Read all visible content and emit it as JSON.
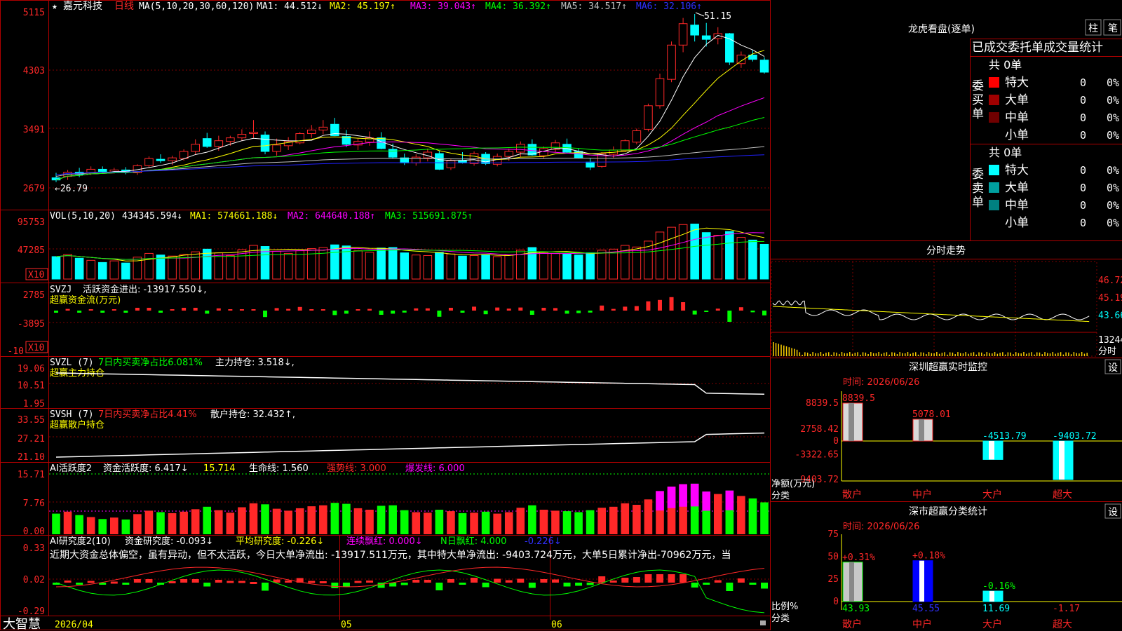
{
  "app": {
    "brand": "大智慧",
    "stock_name": "嘉元科技",
    "period": "日线",
    "marker": "★"
  },
  "colors": {
    "up": "#ff2828",
    "down": "#00ffff",
    "ma1": "#ffffff",
    "ma2": "#ffff00",
    "ma3": "#ff00ff",
    "ma4": "#00ff00",
    "ma5": "#c0c0c0",
    "ma6": "#2020ff",
    "grid": "#b00000"
  },
  "main": {
    "legend": {
      "ma_label": "MA(5,10,20,30,60,120)",
      "ma1": "MA1: 44.512↓",
      "ma2": "MA2: 45.197↑",
      "ma3": "MA3: 39.043↑",
      "ma4": "MA4: 36.392↑",
      "ma5": "MA5: 34.517↑",
      "ma6": "MA6: 32.106↑"
    },
    "yticks": [
      "5115",
      "4303",
      "3491",
      "2679"
    ],
    "high_label": "51.15",
    "low_label": "←26.79"
  },
  "vol": {
    "label": "VOL(5,10,20)",
    "value": "434345.594↓",
    "ma1": "MA1: 574661.188↓",
    "ma2": "MA2: 644640.188↑",
    "ma3": "MA3: 515691.875↑",
    "yticks": [
      "95753",
      "47285"
    ],
    "unit": "X10"
  },
  "svzj": {
    "label": "SVZJ",
    "text": "活跃资金进出: -13917.550↓,",
    "title": "超赢资金流(万元)",
    "yticks": [
      "2785",
      "-3895",
      "-10"
    ],
    "unit": "X10"
  },
  "svzl": {
    "label": "SVZL (7)",
    "text1": "7日内买卖净占比6.081%",
    "text2": "主力持仓: 3.518↓,",
    "title": "超赢主力持仓",
    "yticks": [
      "19.06",
      "10.51",
      "1.95"
    ]
  },
  "svsh": {
    "label": "SVSH (7)",
    "text1": "7日内买卖净占比4.41%",
    "text2": "散户持仓: 32.432↑,",
    "title": "超赢散户持仓",
    "yticks": [
      "33.55",
      "27.21",
      "21.10"
    ]
  },
  "ai1": {
    "label": "AI活跃度2",
    "t1": "资金活跃度: 6.417↓",
    "t2": "15.714",
    "t3": "生命线: 1.560",
    "t4": "强势线: 3.000",
    "t5": "爆发线: 6.000",
    "yticks": [
      "15.71",
      "7.76",
      "0.00"
    ]
  },
  "ai2": {
    "label": "AI研究度2(10)",
    "t1": "资金研究度: -0.093↓",
    "t2": "平均研究度: -0.226↓",
    "t3": "连续飘红: 0.000↓",
    "t4": "N日飘红: 4.000",
    "t5": "-0.226↓",
    "note": "近期大资金总体偏空，虽有异动，但不太活跃，今日大单净流出: -13917.511万元，其中特大单净流出: -9403.724万元，大单5日累计净出-70962万元，当",
    "yticks": [
      "0.33",
      "0.02",
      "-0.29"
    ]
  },
  "xaxis": {
    "labels": [
      "2026/04",
      "05",
      "06"
    ]
  },
  "dragon": {
    "title": "龙虎看盘(逐单)",
    "btn1": "柱",
    "btn2": "笔",
    "header": "已成交委托单成交量统计",
    "buy_label": "委买单",
    "sell_label": "委卖单",
    "buy_total": "共 0单",
    "sell_total": "共 0单",
    "buy_rows": [
      {
        "name": "特大",
        "count": "0",
        "pct": "0%",
        "color": "#ff0000"
      },
      {
        "name": "大单",
        "count": "0",
        "pct": "0%",
        "color": "#a00000"
      },
      {
        "name": "中单",
        "count": "0",
        "pct": "0%",
        "color": "#700000"
      },
      {
        "name": "小单",
        "count": "0",
        "pct": "0%",
        "color": ""
      }
    ],
    "sell_rows": [
      {
        "name": "特大",
        "count": "0",
        "pct": "0%",
        "color": "#00ffff"
      },
      {
        "name": "大单",
        "count": "0",
        "pct": "0%",
        "color": "#00a0a0"
      },
      {
        "name": "中单",
        "count": "0",
        "pct": "0%",
        "color": "#008080"
      },
      {
        "name": "小单",
        "count": "0",
        "pct": "0%",
        "color": ""
      }
    ]
  },
  "intraday": {
    "title": "分时走势",
    "yticks": [
      "46.72",
      "45.19",
      "43.66"
    ],
    "vol_tick": "13244",
    "vol_label": "分时"
  },
  "monitor": {
    "title": "深圳超赢实时监控",
    "btn": "设",
    "time": "时间: 2026/06/26",
    "yticks": [
      "8839.5",
      "2758.42",
      "0",
      "-3322.65",
      "-9403.72"
    ],
    "axis_label1": "净额(万元)",
    "axis_label2": "分类",
    "bars": [
      {
        "cat": "散户",
        "value": 8839.5,
        "label": "8839.5"
      },
      {
        "cat": "中户",
        "value": 5078.01,
        "label": "5078.01"
      },
      {
        "cat": "大户",
        "value": -4513.79,
        "label": "-4513.79"
      },
      {
        "cat": "超大",
        "value": -9403.72,
        "label": "-9403.72"
      }
    ]
  },
  "classify": {
    "title": "深市超赢分类统计",
    "btn": "设",
    "time": "时间: 2026/06/26",
    "yticks": [
      "75",
      "50",
      "25",
      "0"
    ],
    "axis_label1": "比例%",
    "axis_label2": "分类",
    "bars": [
      {
        "cat": "散户",
        "value": 43.93,
        "label": "43.93",
        "delta": "+0.31%"
      },
      {
        "cat": "中户",
        "value": 45.55,
        "label": "45.55",
        "delta": "+0.18%"
      },
      {
        "cat": "大户",
        "value": 11.69,
        "label": "11.69",
        "delta": "-0.16%"
      },
      {
        "cat": "超大",
        "value": -1.17,
        "label": "-1.17",
        "delta": ""
      }
    ]
  },
  "chart_data": {
    "type": "candlestick",
    "title": "嘉元科技 日线",
    "ylim": [
      26.79,
      51.15
    ],
    "ohlc": [
      [
        28.2,
        28.9,
        27.6,
        27.9
      ],
      [
        28.4,
        29.3,
        27.9,
        29.0
      ],
      [
        29.0,
        29.6,
        28.3,
        28.7
      ],
      [
        28.9,
        29.8,
        28.6,
        29.4
      ],
      [
        29.4,
        29.8,
        28.9,
        29.1
      ],
      [
        29.0,
        29.6,
        28.8,
        29.3
      ],
      [
        29.3,
        29.7,
        28.7,
        29.0
      ],
      [
        28.9,
        30.1,
        28.6,
        29.9
      ],
      [
        29.9,
        31.2,
        29.6,
        30.9
      ],
      [
        30.8,
        31.5,
        30.3,
        30.6
      ],
      [
        30.6,
        31.3,
        30.0,
        31.0
      ],
      [
        30.9,
        32.2,
        30.6,
        31.9
      ],
      [
        31.9,
        33.6,
        31.4,
        32.9
      ],
      [
        33.7,
        34.5,
        32.4,
        32.6
      ],
      [
        32.6,
        34.1,
        32.0,
        33.4
      ],
      [
        33.3,
        34.1,
        32.7,
        33.8
      ],
      [
        33.8,
        35.0,
        33.4,
        34.3
      ],
      [
        34.4,
        36.3,
        33.8,
        34.6
      ],
      [
        34.2,
        34.7,
        31.5,
        31.9
      ],
      [
        31.9,
        33.7,
        31.3,
        32.8
      ],
      [
        32.7,
        33.9,
        32.1,
        33.3
      ],
      [
        33.1,
        34.6,
        32.9,
        34.4
      ],
      [
        34.4,
        35.6,
        33.8,
        34.9
      ],
      [
        34.9,
        36.3,
        34.3,
        35.3
      ],
      [
        35.7,
        36.6,
        34.6,
        34.1
      ],
      [
        34.0,
        34.9,
        32.5,
        32.9
      ],
      [
        32.8,
        33.7,
        32.1,
        33.3
      ],
      [
        33.2,
        34.7,
        32.7,
        33.8
      ],
      [
        33.8,
        34.6,
        32.2,
        32.3
      ],
      [
        32.2,
        33.0,
        30.9,
        31.1
      ],
      [
        31.0,
        31.6,
        30.0,
        30.3
      ],
      [
        30.3,
        31.5,
        29.9,
        31.1
      ],
      [
        31.0,
        32.3,
        30.5,
        31.8
      ],
      [
        31.6,
        32.0,
        29.3,
        29.4
      ],
      [
        29.6,
        30.8,
        29.3,
        30.6
      ],
      [
        30.6,
        31.8,
        30.2,
        30.3
      ],
      [
        30.2,
        31.9,
        29.9,
        31.6
      ],
      [
        31.5,
        31.8,
        30.0,
        30.2
      ],
      [
        30.1,
        31.6,
        29.8,
        31.2
      ],
      [
        31.2,
        32.3,
        30.6,
        31.9
      ],
      [
        31.8,
        33.3,
        31.1,
        32.9
      ],
      [
        32.9,
        33.6,
        31.3,
        31.4
      ],
      [
        31.3,
        32.6,
        30.9,
        32.3
      ],
      [
        32.2,
        33.5,
        31.8,
        33.1
      ],
      [
        32.9,
        33.7,
        31.7,
        31.8
      ],
      [
        31.9,
        32.3,
        30.9,
        31.0
      ],
      [
        30.4,
        31.0,
        29.3,
        29.7
      ],
      [
        29.8,
        31.8,
        29.6,
        31.6
      ],
      [
        31.5,
        32.6,
        31.0,
        32.1
      ],
      [
        32.0,
        33.6,
        31.8,
        33.4
      ],
      [
        33.2,
        35.1,
        32.9,
        34.8
      ],
      [
        35.0,
        38.6,
        34.7,
        38.3
      ],
      [
        38.3,
        42.8,
        37.9,
        42.1
      ],
      [
        42.0,
        47.3,
        41.6,
        46.8
      ],
      [
        46.8,
        50.6,
        45.8,
        49.8
      ],
      [
        49.6,
        51.15,
        47.3,
        48.2
      ],
      [
        48.1,
        49.9,
        46.6,
        47.6
      ],
      [
        47.7,
        49.3,
        46.9,
        48.4
      ],
      [
        48.4,
        48.5,
        44.0,
        44.4
      ],
      [
        44.2,
        45.9,
        43.6,
        45.4
      ],
      [
        45.4,
        46.1,
        44.5,
        44.8
      ],
      [
        44.7,
        45.1,
        42.8,
        43.0
      ]
    ],
    "volume": [
      4.2,
      4.6,
      3.9,
      3.5,
      3.1,
      3.4,
      3.0,
      4.1,
      4.8,
      4.5,
      4.3,
      4.6,
      5.1,
      5.6,
      4.9,
      4.4,
      5.5,
      6.3,
      6.1,
      5.2,
      4.8,
      5.3,
      5.7,
      5.9,
      6.4,
      6.2,
      5.3,
      5.0,
      5.8,
      5.9,
      4.9,
      4.5,
      4.4,
      5.0,
      4.7,
      4.3,
      4.4,
      4.6,
      4.2,
      4.5,
      5.4,
      5.9,
      5.0,
      4.8,
      4.7,
      4.5,
      4.9,
      5.4,
      5.6,
      6.3,
      6.0,
      7.1,
      8.8,
      9.7,
      10.2,
      10.3,
      8.7,
      8.2,
      8.9,
      7.8,
      7.3,
      6.5
    ]
  }
}
